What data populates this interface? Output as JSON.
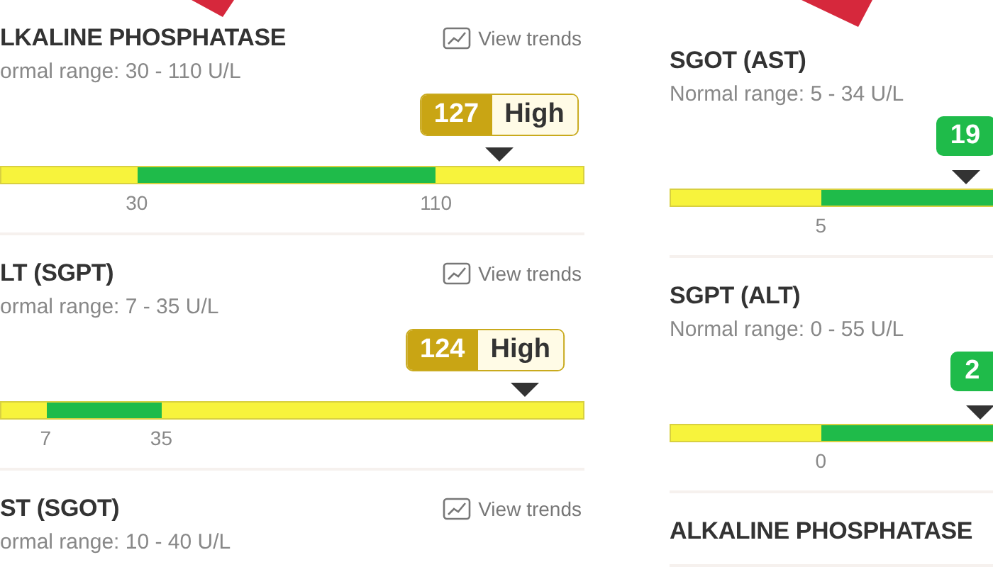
{
  "panels": [
    {
      "cards": [
        {
          "title": "LKALINE PHOSPHATASE",
          "range": "ormal range: 30 - 110 U/L",
          "trends": "View trends",
          "result": {
            "kind": "high",
            "value": "127",
            "label": "High",
            "level": 0.854
          },
          "band": {
            "start": {
              "level": 0.234
            },
            "end": {
              "level": 0.746
            }
          },
          "ticks": [
            "30",
            "110"
          ]
        },
        {
          "title": "LT (SGPT)",
          "range": "ormal range: 7 - 35 U/L",
          "trends": "View trends",
          "result": {
            "kind": "high",
            "value": "124",
            "label": "High",
            "level": 0.898
          },
          "band": {
            "start": {
              "level": 0.078
            },
            "end": {
              "level": 0.276
            }
          },
          "ticks": [
            "7",
            "35"
          ]
        },
        {
          "title": "ST (SGOT)",
          "range": "ormal range: 10 - 40 U/L",
          "trends": "View trends"
        }
      ]
    },
    {
      "cards": [
        {
          "title": "SGOT (AST)",
          "range": "Normal range: 5 - 34 U/L",
          "result": {
            "kind": "normal",
            "value": "19",
            "level": 0.507
          },
          "band": {
            "start": {
              "level": 0.259
            },
            "end": {
              "level": 1
            }
          },
          "ticks": [
            "5"
          ]
        },
        {
          "title": "SGPT (ALT)",
          "range": "Normal range: 0 - 55 U/L",
          "result": {
            "kind": "normal",
            "value": "2",
            "level": 0.532
          },
          "band": {
            "start": {
              "level": 0.259
            },
            "end": {
              "level": 1
            }
          },
          "ticks": [
            "0"
          ]
        },
        {
          "title": "ALKALINE PHOSPHATASE"
        }
      ]
    }
  ]
}
